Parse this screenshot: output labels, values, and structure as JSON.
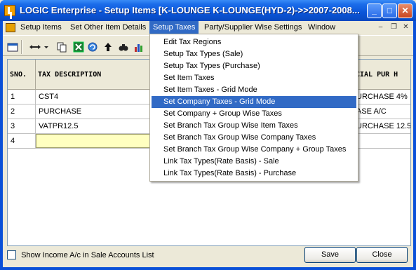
{
  "window": {
    "title": "LOGIC Enterprise - Setup Items  [K-LOUNGE K-LOUNGE(HYD-2)->>2007-2008...",
    "minimize": "_",
    "maximize": "□",
    "close": "✕"
  },
  "menubar": {
    "items": [
      {
        "label": "Setup Items"
      },
      {
        "label": "Set Other Item Details"
      },
      {
        "label": "Setup Taxes"
      },
      {
        "label": "Party/Supplier Wise Settings"
      },
      {
        "label": "Window"
      }
    ],
    "active_index": 2,
    "mdi_minimize": "–",
    "mdi_restore": "❐",
    "mdi_close": "✕"
  },
  "toolbar": {
    "icons": [
      "new-icon",
      "move-icon",
      "dropdown-arrow-icon",
      "copy-icon",
      "excel-icon",
      "refresh-icon",
      "up-arrow-icon",
      "find-icon",
      "chart-icon"
    ]
  },
  "grid": {
    "headers": {
      "sno": "SNO.",
      "desc": "TAX DESCRIPTION",
      "spec": "CIAL PUR H"
    },
    "rows": [
      {
        "sno": "1",
        "desc": "CST4",
        "spec": "URCHASE 4%"
      },
      {
        "sno": "2",
        "desc": "PURCHASE",
        "spec": "ASE A/C"
      },
      {
        "sno": "3",
        "desc": "VATPR12.5",
        "spec": "URCHASE 12.5"
      },
      {
        "sno": "4",
        "desc": "",
        "spec": ""
      }
    ]
  },
  "dropdown": {
    "items": [
      "Edit Tax Regions",
      "Setup Tax Types (Sale)",
      "Setup Tax Types (Purchase)",
      "Set Item Taxes",
      "Set Item Taxes - Grid Mode",
      "Set Company Taxes - Grid Mode",
      "Set Company + Group Wise Taxes",
      "Set Branch Tax Group Wise Item Taxes",
      "Set Branch Tax Group Wise Company Taxes",
      "Set Branch Tax Group Wise Company + Group Taxes",
      "Link Tax Types(Rate Basis) - Sale",
      "Link Tax Types(Rate Basis) - Purchase"
    ],
    "highlighted_index": 5
  },
  "footer": {
    "checkbox_label": "Show Income A/c in Sale Accounts List",
    "checkbox_checked": false,
    "save_label": "Save",
    "close_label": "Close"
  },
  "colors": {
    "titlebar": "#0A55D8",
    "menu_highlight": "#316AC5",
    "current_cell": "#FFFFC0"
  }
}
